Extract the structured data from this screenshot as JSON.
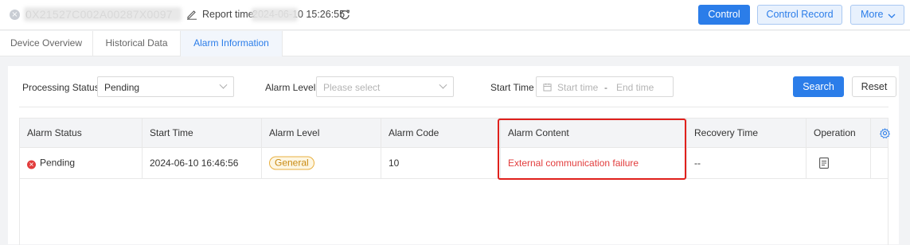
{
  "header": {
    "close_glyph": "×",
    "device_id": "0X21527C002A00287X0097",
    "report_label": "Report time:",
    "report_time": "2024-06-10 15:26:55",
    "buttons": {
      "control": "Control",
      "control_record": "Control Record",
      "more": "More"
    }
  },
  "tabs": [
    {
      "label": "Device Overview"
    },
    {
      "label": "Historical Data"
    },
    {
      "label": "Alarm Information",
      "active": true
    }
  ],
  "filters": {
    "processing_status_label": "Processing Status",
    "processing_status_value": "Pending",
    "alarm_level_label": "Alarm Level",
    "alarm_level_placeholder": "Please select",
    "start_time_label": "Start Time",
    "start_time_placeholder": "Start time",
    "range_separator": "-",
    "end_time_placeholder": "End time",
    "search": "Search",
    "reset": "Reset"
  },
  "table": {
    "columns": [
      "Alarm Status",
      "Start Time",
      "Alarm Level",
      "Alarm Code",
      "Alarm Content",
      "Recovery Time",
      "Operation"
    ],
    "rows": [
      {
        "status": "Pending",
        "start_time": "2024-06-10 16:46:56",
        "level": "General",
        "code": "10",
        "content": "External communication failure",
        "recovery_time": "--"
      }
    ]
  },
  "colors": {
    "primary": "#2b7de9",
    "danger": "#e23c3c",
    "warning_badge": "#e9b040",
    "highlight_box": "#e0201c"
  },
  "icons": [
    "close-icon",
    "edit-icon",
    "refresh-icon",
    "chevron-down-icon",
    "calendar-icon",
    "settings-gear-icon",
    "document-icon",
    "status-error-icon"
  ]
}
